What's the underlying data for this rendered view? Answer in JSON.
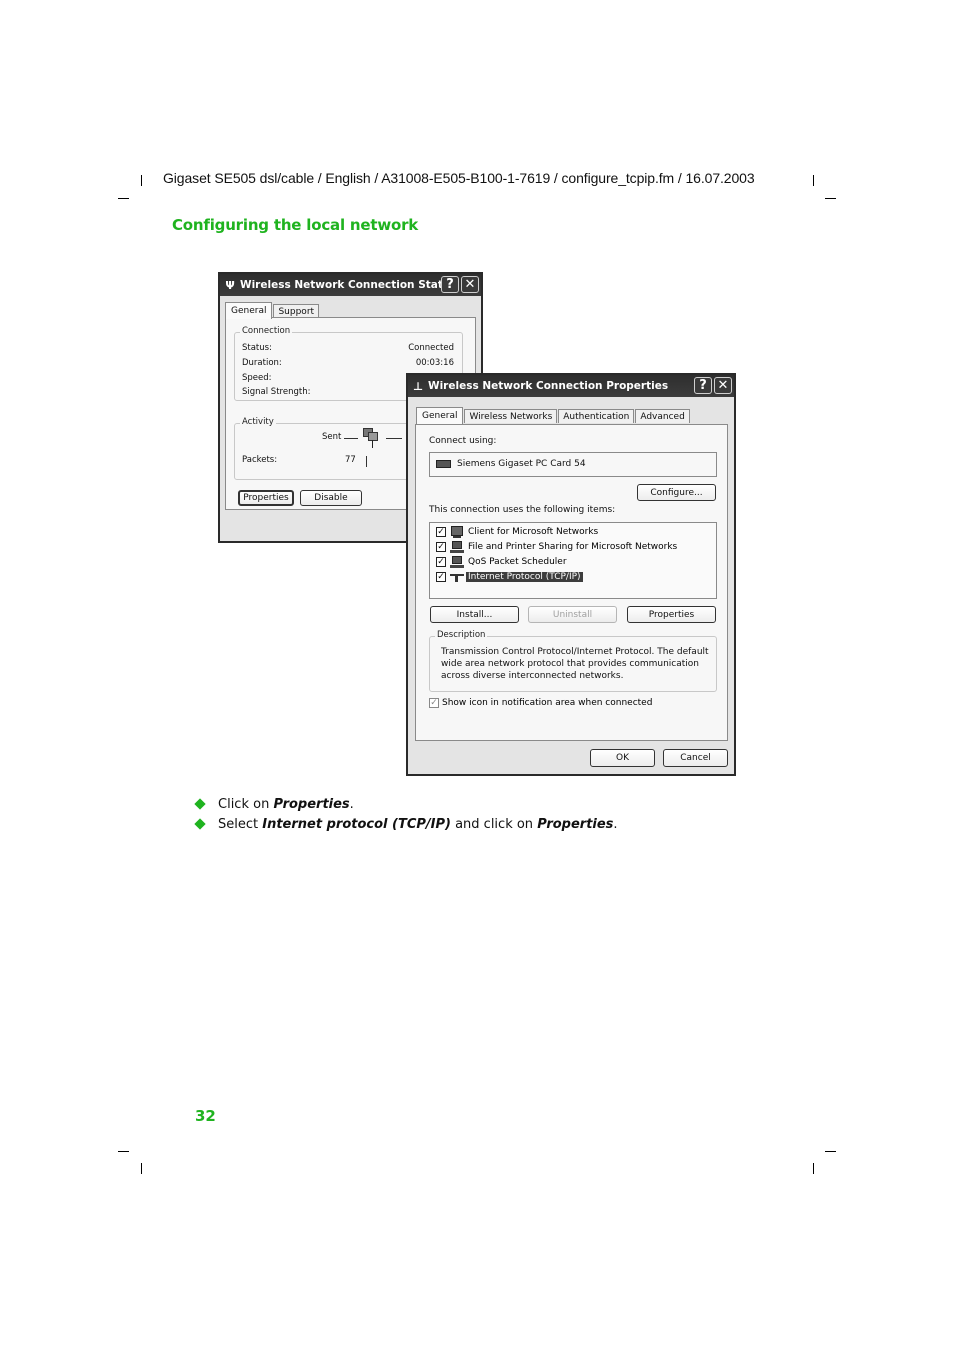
{
  "header": {
    "running_head": "Gigaset SE505 dsl/cable / English / A31008-E505-B100-1-7619 / configure_tcpip.fm / 16.07.2003",
    "section_title": "Configuring the local network"
  },
  "status_dialog": {
    "title": "Wireless Network Connection Status",
    "title_icon": "antenna-icon",
    "help_glyph": "?",
    "close_glyph": "✕",
    "tabs": [
      {
        "label": "General",
        "active": true
      },
      {
        "label": "Support",
        "active": false
      }
    ],
    "connection": {
      "legend": "Connection",
      "rows": [
        {
          "label": "Status:",
          "value": "Connected"
        },
        {
          "label": "Duration:",
          "value": "00:03:16"
        },
        {
          "label": "Speed:",
          "value": ""
        },
        {
          "label": "Signal Strength:",
          "value": ""
        }
      ]
    },
    "activity": {
      "legend": "Activity",
      "sent_label": "Sent",
      "packets_label": "Packets:",
      "packets_sent": "77"
    },
    "buttons": {
      "properties": "Properties",
      "disable": "Disable"
    }
  },
  "properties_dialog": {
    "title": "Wireless Network Connection Properties",
    "title_icon": "antenna-icon",
    "help_glyph": "?",
    "close_glyph": "✕",
    "tabs": [
      {
        "label": "General",
        "active": true
      },
      {
        "label": "Wireless Networks",
        "active": false
      },
      {
        "label": "Authentication",
        "active": false
      },
      {
        "label": "Advanced",
        "active": false
      }
    ],
    "connect_using_label": "Connect using:",
    "adapter_name": "Siemens Gigaset PC Card 54",
    "configure_button": "Configure...",
    "items_label": "This connection uses the following items:",
    "items": [
      {
        "label": "Client for Microsoft Networks",
        "checked": true,
        "icon": "network-client-icon",
        "selected": false
      },
      {
        "label": "File and Printer Sharing for Microsoft Networks",
        "checked": true,
        "icon": "computer-icon",
        "selected": false
      },
      {
        "label": "QoS Packet Scheduler",
        "checked": true,
        "icon": "computer-icon",
        "selected": false
      },
      {
        "label": "Internet Protocol (TCP/IP)",
        "checked": true,
        "icon": "protocol-icon",
        "selected": true
      }
    ],
    "buttons": {
      "install": "Install...",
      "uninstall": "Uninstall",
      "properties": "Properties",
      "ok": "OK",
      "cancel": "Cancel"
    },
    "description": {
      "legend": "Description",
      "lines": [
        "Transmission Control Protocol/Internet Protocol. The default",
        "wide area network protocol that provides communication",
        "across diverse interconnected networks."
      ]
    },
    "show_icon_checkbox": {
      "label": "Show icon in notification area when connected",
      "checked": true
    }
  },
  "instructions": [
    {
      "pre": "Click on ",
      "em1": "Properties",
      "mid": "",
      "em2": "",
      "post": "."
    },
    {
      "pre": "Select ",
      "em1": "Internet protocol (TCP/IP)",
      "mid": " and click on ",
      "em2": "Properties",
      "post": "."
    }
  ],
  "footer": {
    "page_number": "32"
  },
  "colors": {
    "accent_green": "#1fb31f",
    "titlebar": "#333333",
    "selection": "#3d3d3d"
  }
}
